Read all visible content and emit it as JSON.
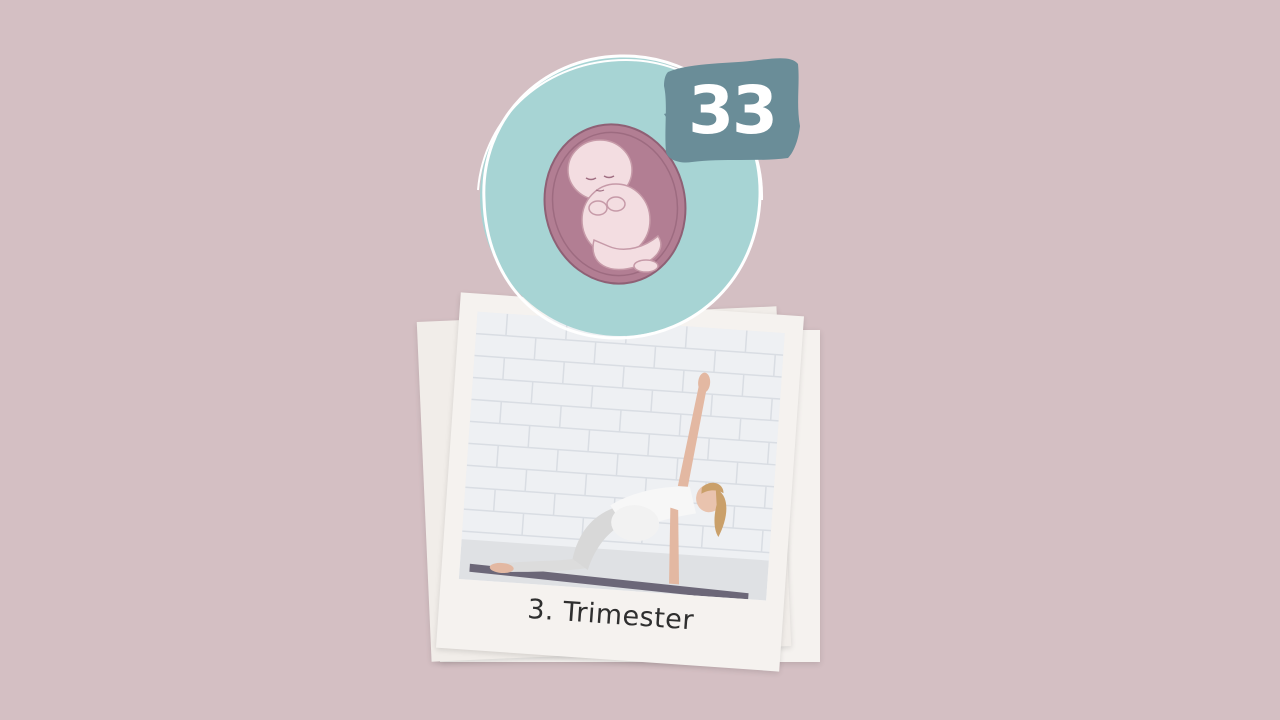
{
  "week": {
    "number": "33"
  },
  "photo": {
    "caption": "3. Trimester"
  },
  "colors": {
    "background": "#d4bfc3",
    "circle": "#a7d4d4",
    "badge": "#6a8d98",
    "womb": "#b27e93",
    "baby_skin": "#f3dde1",
    "polaroid": "#f5f2ef"
  },
  "icons": {
    "baby_illustration": "fetus-in-womb-icon"
  }
}
